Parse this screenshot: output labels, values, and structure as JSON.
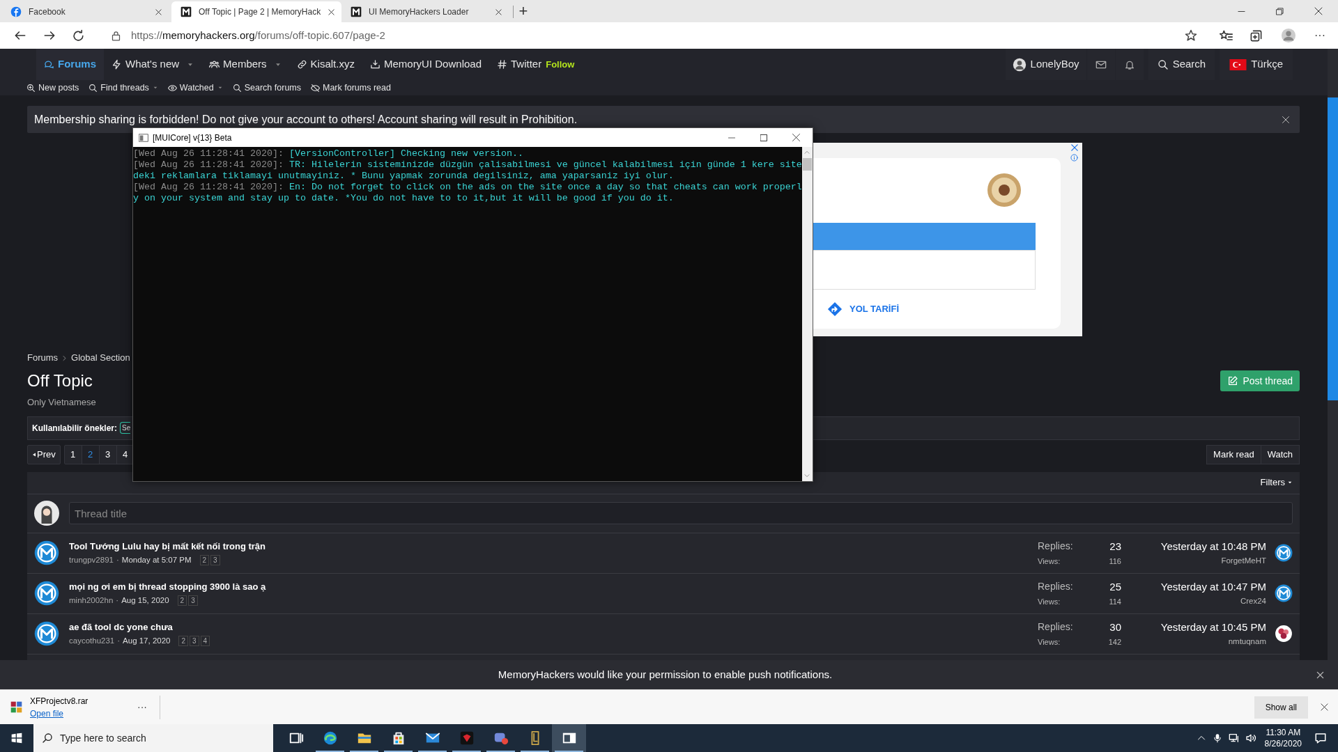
{
  "browser": {
    "tabs": [
      {
        "title": "Facebook",
        "selected": false
      },
      {
        "title": "Off Topic | Page 2 | MemoryHack",
        "selected": true
      },
      {
        "title": "UI MemoryHackers Loader",
        "selected": false
      }
    ],
    "new_tab": "+",
    "url": {
      "scheme": "https://",
      "domain": "memoryhackers.org",
      "path": "/forums/off-topic.607/page-2"
    },
    "menu": "···"
  },
  "nav": {
    "items": [
      {
        "label": "Forums",
        "caret": false,
        "selected": true
      },
      {
        "label": "What's new",
        "caret": true,
        "selected": false
      },
      {
        "label": "Members",
        "caret": true,
        "selected": false
      },
      {
        "label": "Kisalt.xyz",
        "caret": false,
        "selected": false
      },
      {
        "label": "MemoryUI Download",
        "caret": false,
        "selected": false
      },
      {
        "label": "Twitter",
        "caret": false,
        "selected": false,
        "badge": "Follow"
      }
    ],
    "user": "LonelyBoy",
    "search": "Search",
    "language": "Türkçe"
  },
  "subnav": [
    {
      "label": "New posts",
      "caret": false
    },
    {
      "label": "Find threads",
      "caret": true
    },
    {
      "label": "Watched",
      "caret": true
    },
    {
      "label": "Search forums",
      "caret": false
    },
    {
      "label": "Mark forums read",
      "caret": false
    }
  ],
  "notice": "Membership sharing is forbidden! Do not give your account to others! Account sharing will result in Prohibition.",
  "console": {
    "title": "[MUICore] v{13} Beta",
    "lines": [
      {
        "stamp": "[Wed Aug 26 11:28:41 2020]:",
        "text": " [VersionController] Checking new version.."
      },
      {
        "stamp": "[Wed Aug 26 11:28:41 2020]:",
        "text": " TR: Hilelerin sisteminizde düzgün çalisabilmesi ve güncel kalabilmesi için günde 1 kere site"
      },
      {
        "text": "deki reklamlara tiklamayi unutmayiniz. * Bunu yapmak zorunda degilsiniz, ama yaparsaniz iyi olur."
      },
      {
        "stamp": "[Wed Aug 26 11:28:41 2020]:",
        "text": " En: Do not forget to click on the ads on the site once a day so that cheats can work properl"
      },
      {
        "text": "y on your system and stay up to date. *You do not have to to it,but it will be good if you do it."
      }
    ]
  },
  "ad": {
    "action": "YOL TARİFİ"
  },
  "forum": {
    "breadcrumb": [
      "Forums",
      "Global Section"
    ],
    "title": "Off Topic",
    "description": "Only Vietnamese",
    "prefix_label": "Kullanılabilir önekler:",
    "prefix": "Se",
    "prev": "Prev",
    "pages": [
      {
        "label": "1",
        "selected": false
      },
      {
        "label": "2",
        "selected": true
      },
      {
        "label": "3",
        "selected": false
      },
      {
        "label": "4",
        "selected": false
      }
    ],
    "post_thread": "Post thread",
    "mark_read": "Mark read",
    "watch": "Watch",
    "filters": "Filters",
    "thread_placeholder": "Thread title",
    "threads": [
      {
        "title": "Tool Tướng Lulu hay bị mất kết nối trong trận",
        "author": "trungpv2891",
        "separator": "·",
        "date": "Monday at 5:07 PM",
        "pages": [
          "2",
          "3"
        ],
        "replies_label": "Replies:",
        "replies": "23",
        "views_label": "Views:",
        "views": "116",
        "last_date": "Yesterday at 10:48 PM",
        "last_user": "ForgetMeHT",
        "last_avatar": {
          "kind": "logo"
        }
      },
      {
        "title": "mọi ng ơi em bị thread stopping 3900 là sao ạ",
        "author": "minh2002hn",
        "separator": "·",
        "date": "Aug 15, 2020",
        "pages": [
          "2",
          "3"
        ],
        "replies_label": "Replies:",
        "replies": "25",
        "views_label": "Views:",
        "views": "114",
        "last_date": "Yesterday at 10:47 PM",
        "last_user": "Crex24",
        "last_avatar": {
          "kind": "logo"
        }
      },
      {
        "title": "ae đã tool dc yone chưa",
        "author": "caycothu231",
        "separator": "·",
        "date": "Aug 17, 2020",
        "pages": [
          "2",
          "3",
          "4"
        ],
        "replies_label": "Replies:",
        "replies": "30",
        "views_label": "Views:",
        "views": "142",
        "last_date": "Yesterday at 10:45 PM",
        "last_user": "nmtuqnam",
        "last_avatar": {
          "kind": "flower"
        }
      }
    ]
  },
  "push": "MemoryHackers would like your permission to enable push notifications.",
  "download": {
    "file": "XFProjectv8.rar",
    "open": "Open file",
    "more": "···",
    "show_all": "Show all"
  },
  "taskbar": {
    "search": "Type here to search",
    "time": "11:30 AM",
    "date": "8/26/2020"
  }
}
